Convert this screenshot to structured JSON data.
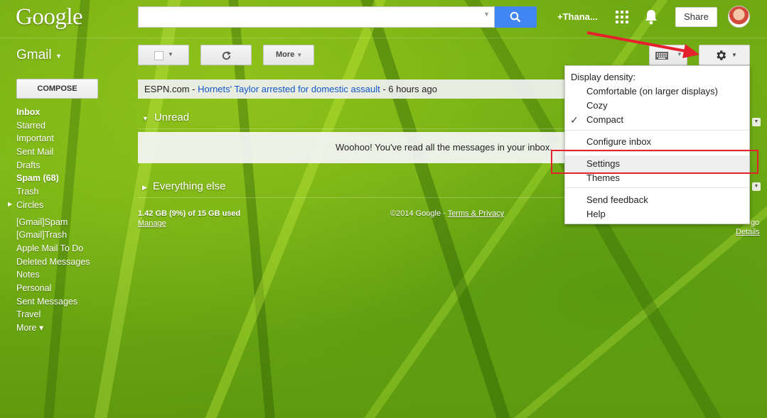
{
  "header": {
    "logo": "Google",
    "user_name": "+Thana...",
    "share_label": "Share"
  },
  "app": {
    "name": "Gmail"
  },
  "toolbar": {
    "more_label": "More"
  },
  "sidebar": {
    "compose_label": "COMPOSE",
    "items": [
      {
        "label": "Inbox"
      },
      {
        "label": "Starred"
      },
      {
        "label": "Important"
      },
      {
        "label": "Sent Mail"
      },
      {
        "label": "Drafts"
      },
      {
        "label": "Spam (68)"
      },
      {
        "label": "Trash"
      },
      {
        "label": "Circles"
      },
      {
        "label": "[Gmail]Spam"
      },
      {
        "label": "[Gmail]Trash"
      },
      {
        "label": "Apple Mail To Do"
      },
      {
        "label": "Deleted Messages"
      },
      {
        "label": "Notes"
      },
      {
        "label": "Personal"
      },
      {
        "label": "Sent Messages"
      },
      {
        "label": "Travel"
      },
      {
        "label": "More ▾"
      }
    ]
  },
  "news": {
    "source": "ESPN.com - ",
    "headline": "Hornets' Taylor arrested for domestic assault",
    "age": " - 6 hours ago"
  },
  "sections": {
    "unread": "Unread",
    "empty_message": "Woohoo! You've read all the messages in your inbox.",
    "everything_else": "Everything else"
  },
  "footer": {
    "storage": "1.42 GB (9%) of 15 GB used",
    "manage": "Manage",
    "copyright": "©2014 Google - ",
    "terms": "Terms & Privacy",
    "right_fragment": "go",
    "details": "Details"
  },
  "settings_menu": {
    "header": "Display density:",
    "density_options": [
      {
        "label": "Comfortable (on larger displays)"
      },
      {
        "label": "Cozy"
      },
      {
        "label": "Compact",
        "checked": true
      }
    ],
    "configure": "Configure inbox",
    "settings": "Settings",
    "themes": "Themes",
    "feedback": "Send feedback",
    "help": "Help"
  },
  "colors": {
    "search_button": "#4285f4",
    "annotation_red": "#e5212d",
    "link_blue": "#1155cc"
  }
}
